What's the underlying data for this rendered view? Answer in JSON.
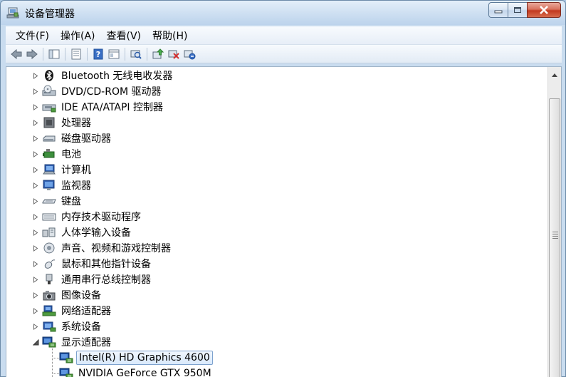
{
  "window": {
    "title": "设备管理器",
    "buttons": {
      "minimize": "minimize",
      "maximize": "maximize",
      "close": "close"
    }
  },
  "menu": [
    {
      "label": "文件(F)"
    },
    {
      "label": "操作(A)"
    },
    {
      "label": "查看(V)"
    },
    {
      "label": "帮助(H)"
    }
  ],
  "toolbar": {
    "icons": [
      "back-arrow-icon",
      "forward-arrow-icon",
      "show-hide-tree-icon",
      "properties-icon",
      "help-icon",
      "view-icon",
      "scan-hardware-icon",
      "update-driver-icon",
      "disable-device-icon",
      "uninstall-device-icon"
    ]
  },
  "tree": {
    "categories": [
      {
        "label": "Bluetooth 无线电收发器",
        "icon": "bluetooth-icon",
        "expanded": false
      },
      {
        "label": "DVD/CD-ROM 驱动器",
        "icon": "dvd-drive-icon",
        "expanded": false
      },
      {
        "label": "IDE ATA/ATAPI 控制器",
        "icon": "ide-controller-icon",
        "expanded": false
      },
      {
        "label": "处理器",
        "icon": "processor-icon",
        "expanded": false
      },
      {
        "label": "磁盘驱动器",
        "icon": "disk-drive-icon",
        "expanded": false
      },
      {
        "label": "电池",
        "icon": "battery-icon",
        "expanded": false
      },
      {
        "label": "计算机",
        "icon": "computer-icon",
        "expanded": false
      },
      {
        "label": "监视器",
        "icon": "monitor-icon",
        "expanded": false
      },
      {
        "label": "键盘",
        "icon": "keyboard-icon",
        "expanded": false
      },
      {
        "label": "内存技术驱动程序",
        "icon": "memory-tech-icon",
        "expanded": false
      },
      {
        "label": "人体学输入设备",
        "icon": "hid-icon",
        "expanded": false
      },
      {
        "label": "声音、视频和游戏控制器",
        "icon": "sound-icon",
        "expanded": false
      },
      {
        "label": "鼠标和其他指针设备",
        "icon": "mouse-icon",
        "expanded": false
      },
      {
        "label": "通用串行总线控制器",
        "icon": "usb-icon",
        "expanded": false
      },
      {
        "label": "图像设备",
        "icon": "camera-icon",
        "expanded": false
      },
      {
        "label": "网络适配器",
        "icon": "network-adapter-icon",
        "expanded": false
      },
      {
        "label": "系统设备",
        "icon": "system-device-icon",
        "expanded": false
      },
      {
        "label": "显示适配器",
        "icon": "display-adapter-icon",
        "expanded": true
      }
    ],
    "display_children": [
      {
        "label": "Intel(R) HD Graphics 4600",
        "icon": "display-adapter-icon",
        "selected": true
      },
      {
        "label": "NVIDIA GeForce GTX 950M",
        "icon": "display-adapter-icon",
        "selected": false
      }
    ]
  },
  "colors": {
    "selection_border": "#7da2ce",
    "frame": "#c9dcef",
    "close_red": "#c2391f"
  }
}
